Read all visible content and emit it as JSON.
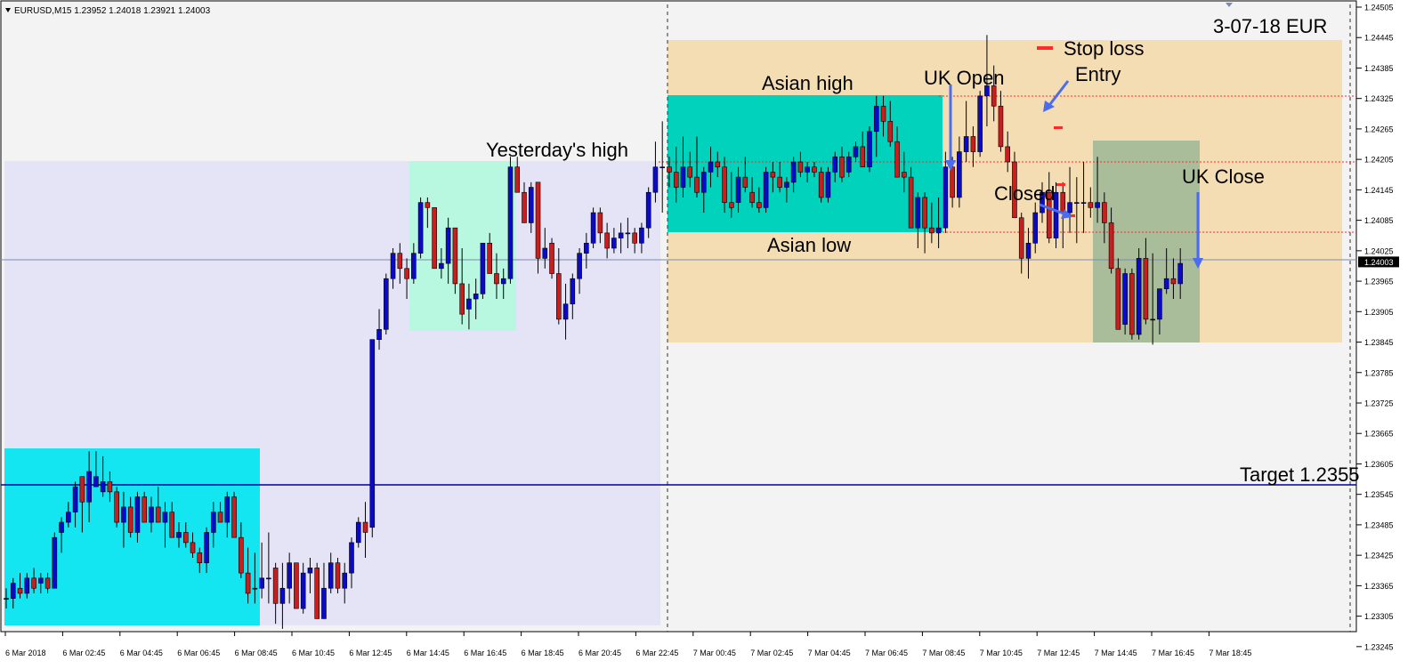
{
  "chart_header": "EURUSD,M15  1.23952 1.24018 1.23921 1.24003",
  "chart_menu_icon": "triangle-down-icon",
  "colors": {
    "background": "#f3f3f3",
    "bull_candle": "#0a0ac8",
    "bear_candle": "#c81e1e",
    "prev_day_zone": "#e4e4f6",
    "today_zone": "#f5ddb3",
    "asian_session_box": "#00d2bc",
    "prev_asian_box": "#13e6f0",
    "yesterday_high_box": "#b8f7e0",
    "uk_session_box": "#a9bd9a",
    "target_line": "#0000a0",
    "level_line": "#ff2a2a",
    "bid_line": "#7a8bb0",
    "annotation_arrow": "#4a6cf0"
  },
  "annotations": {
    "date_label": "3-07-18  EUR",
    "stop_loss": "Stop loss",
    "entry": "Entry",
    "uk_open": "UK Open",
    "asian_high": "Asian high",
    "asian_low": "Asian low",
    "yesterdays_high": "Yesterday's high",
    "closed": "Closed",
    "uk_close": "UK Close",
    "target": "Target  1.2355"
  },
  "price_axis": {
    "labels": [
      "1.24505",
      "1.24445",
      "1.24385",
      "1.24325",
      "1.24265",
      "1.24205",
      "1.24145",
      "1.24085",
      "1.24025",
      "1.23965",
      "1.23905",
      "1.23845",
      "1.23785",
      "1.23725",
      "1.23665",
      "1.23605",
      "1.23545",
      "1.23485",
      "1.23425",
      "1.23365",
      "1.23305",
      "1.23245"
    ],
    "current_price": "1.24003"
  },
  "time_axis": {
    "labels": [
      "6 Mar 2018",
      "6 Mar 02:45",
      "6 Mar 04:45",
      "6 Mar 06:45",
      "6 Mar 08:45",
      "6 Mar 10:45",
      "6 Mar 12:45",
      "6 Mar 14:45",
      "6 Mar 16:45",
      "6 Mar 18:45",
      "6 Mar 20:45",
      "6 Mar 22:45",
      "7 Mar 00:45",
      "7 Mar 02:45",
      "7 Mar 04:45",
      "7 Mar 06:45",
      "7 Mar 08:45",
      "7 Mar 10:45",
      "7 Mar 12:45",
      "7 Mar 14:45",
      "7 Mar 16:45",
      "7 Mar 18:45"
    ]
  },
  "chart_data": {
    "type": "candlestick",
    "symbol": "EURUSD",
    "timeframe": "M15",
    "last_bar": {
      "open": 1.23952,
      "high": 1.24018,
      "low": 1.23921,
      "close": 1.24003
    },
    "ylim": [
      1.2322,
      1.2451
    ],
    "levels": {
      "yesterdays_high": 1.2421,
      "asian_high": 1.2434,
      "asian_low": 1.2406,
      "target": 1.2355,
      "current": 1.24003,
      "stop_loss": 1.2445,
      "entry": 1.2431,
      "closed": 1.241
    },
    "candles": [
      [
        1.2334,
        1.2336,
        1.2332,
        1.2334
      ],
      [
        1.2334,
        1.2338,
        1.2332,
        1.2337
      ],
      [
        1.2336,
        1.2339,
        1.2334,
        1.2335
      ],
      [
        1.2335,
        1.2339,
        1.2334,
        1.2338
      ],
      [
        1.2338,
        1.234,
        1.2335,
        1.2336
      ],
      [
        1.2337,
        1.2339,
        1.2335,
        1.2338
      ],
      [
        1.2338,
        1.2339,
        1.2335,
        1.2336
      ],
      [
        1.2336,
        1.2347,
        1.2336,
        1.2346
      ],
      [
        1.2347,
        1.235,
        1.2343,
        1.2349
      ],
      [
        1.2349,
        1.2353,
        1.2348,
        1.2351
      ],
      [
        1.2351,
        1.2357,
        1.2348,
        1.2356
      ],
      [
        1.2358,
        1.2358,
        1.2347,
        1.2353
      ],
      [
        1.2353,
        1.2363,
        1.2349,
        1.2359
      ],
      [
        1.2356,
        1.2363,
        1.2356,
        1.2358
      ],
      [
        1.2355,
        1.2362,
        1.2354,
        1.2357
      ],
      [
        1.2357,
        1.2359,
        1.2353,
        1.2355
      ],
      [
        1.2355,
        1.2356,
        1.2348,
        1.2349
      ],
      [
        1.2349,
        1.2355,
        1.2344,
        1.2352
      ],
      [
        1.2352,
        1.2354,
        1.2346,
        1.2347
      ],
      [
        1.2347,
        1.2355,
        1.2345,
        1.2354
      ],
      [
        1.2354,
        1.2355,
        1.2349,
        1.2349
      ],
      [
        1.2349,
        1.2354,
        1.2347,
        1.2352
      ],
      [
        1.2352,
        1.2356,
        1.2349,
        1.2349
      ],
      [
        1.2349,
        1.2353,
        1.2344,
        1.2351
      ],
      [
        1.2351,
        1.2353,
        1.2346,
        1.2346
      ],
      [
        1.2346,
        1.2349,
        1.2344,
        1.2347
      ],
      [
        1.2347,
        1.2349,
        1.2344,
        1.2345
      ],
      [
        1.2345,
        1.2347,
        1.2342,
        1.2343
      ],
      [
        1.2343,
        1.2344,
        1.2339,
        1.2341
      ],
      [
        1.2341,
        1.2348,
        1.2339,
        1.2347
      ],
      [
        1.2347,
        1.2353,
        1.2344,
        1.2351
      ],
      [
        1.2351,
        1.2353,
        1.2349,
        1.2349
      ],
      [
        1.2349,
        1.2355,
        1.2346,
        1.2354
      ],
      [
        1.2354,
        1.2355,
        1.2347,
        1.2346
      ],
      [
        1.2346,
        1.2349,
        1.2338,
        1.2339
      ],
      [
        1.2339,
        1.2344,
        1.2333,
        1.2335
      ],
      [
        1.2336,
        1.2343,
        1.2333,
        1.2336
      ],
      [
        1.2336,
        1.2345,
        1.2334,
        1.2338
      ],
      [
        1.2338,
        1.2347,
        1.2333,
        1.2338
      ],
      [
        1.234,
        1.2341,
        1.2329,
        1.2333
      ],
      [
        1.2333,
        1.2341,
        1.2328,
        1.2336
      ],
      [
        1.2336,
        1.2343,
        1.2333,
        1.2341
      ],
      [
        1.2341,
        1.2341,
        1.2333,
        1.2332
      ],
      [
        1.2332,
        1.2341,
        1.2331,
        1.2339
      ],
      [
        1.2339,
        1.2342,
        1.2335,
        1.234
      ],
      [
        1.234,
        1.2341,
        1.233,
        1.233
      ],
      [
        1.233,
        1.2341,
        1.233,
        1.2336
      ],
      [
        1.2336,
        1.2343,
        1.2335,
        1.2341
      ],
      [
        1.2341,
        1.2342,
        1.2335,
        1.2336
      ],
      [
        1.2336,
        1.2341,
        1.2333,
        1.2339
      ],
      [
        1.2339,
        1.2346,
        1.2336,
        1.2345
      ],
      [
        1.2345,
        1.235,
        1.2344,
        1.2349
      ],
      [
        1.2349,
        1.2353,
        1.2342,
        1.2347
      ],
      [
        1.2348,
        1.2385,
        1.2346,
        1.2385
      ],
      [
        1.2385,
        1.2391,
        1.2383,
        1.2387
      ],
      [
        1.2387,
        1.2398,
        1.2386,
        1.2397
      ],
      [
        1.2397,
        1.2403,
        1.2395,
        1.2402
      ],
      [
        1.2402,
        1.2404,
        1.2396,
        1.2399
      ],
      [
        1.2399,
        1.2401,
        1.2393,
        1.2397
      ],
      [
        1.2397,
        1.2404,
        1.2396,
        1.2402
      ],
      [
        1.2402,
        1.2413,
        1.2401,
        1.2412
      ],
      [
        1.2412,
        1.2413,
        1.2407,
        1.2411
      ],
      [
        1.2411,
        1.2411,
        1.24,
        1.2399
      ],
      [
        1.2399,
        1.2403,
        1.2397,
        1.24
      ],
      [
        1.24,
        1.2409,
        1.2396,
        1.2407
      ],
      [
        1.2407,
        1.2407,
        1.2394,
        1.2396
      ],
      [
        1.2396,
        1.2403,
        1.2388,
        1.239
      ],
      [
        1.2391,
        1.2396,
        1.2387,
        1.2393
      ],
      [
        1.2393,
        1.2397,
        1.2389,
        1.2394
      ],
      [
        1.2394,
        1.2404,
        1.2393,
        1.2404
      ],
      [
        1.2404,
        1.2406,
        1.2398,
        1.2398
      ],
      [
        1.2398,
        1.2402,
        1.2393,
        1.2396
      ],
      [
        1.2396,
        1.2399,
        1.2393,
        1.2397
      ],
      [
        1.2397,
        1.2421,
        1.2396,
        1.2419
      ],
      [
        1.2419,
        1.2421,
        1.2415,
        1.2414
      ],
      [
        1.2414,
        1.2416,
        1.2411,
        1.2408
      ],
      [
        1.2408,
        1.2416,
        1.2406,
        1.2415
      ],
      [
        1.2416,
        1.2416,
        1.2398,
        1.2401
      ],
      [
        1.2401,
        1.2407,
        1.2399,
        1.2403
      ],
      [
        1.2404,
        1.2405,
        1.2397,
        1.2398
      ],
      [
        1.2398,
        1.2403,
        1.2388,
        1.2389
      ],
      [
        1.2389,
        1.2396,
        1.2385,
        1.2392
      ],
      [
        1.2392,
        1.2398,
        1.2389,
        1.2397
      ],
      [
        1.2397,
        1.2403,
        1.2394,
        1.2402
      ],
      [
        1.2402,
        1.2406,
        1.2399,
        1.2404
      ],
      [
        1.2404,
        1.2411,
        1.2403,
        1.241
      ],
      [
        1.241,
        1.2411,
        1.2404,
        1.2406
      ],
      [
        1.2406,
        1.2408,
        1.2401,
        1.2403
      ],
      [
        1.2403,
        1.2407,
        1.2402,
        1.2405
      ],
      [
        1.2405,
        1.2408,
        1.2402,
        1.2406
      ],
      [
        1.2406,
        1.2409,
        1.2403,
        1.2406
      ],
      [
        1.2406,
        1.2407,
        1.2402,
        1.2404
      ],
      [
        1.2404,
        1.2408,
        1.2402,
        1.2407
      ],
      [
        1.2407,
        1.2415,
        1.2405,
        1.2414
      ],
      [
        1.2414,
        1.2424,
        1.2412,
        1.2419
      ],
      [
        1.2419,
        1.2428,
        1.241,
        1.2419
      ],
      [
        1.2419,
        1.2421,
        1.2415,
        1.2418
      ],
      [
        1.2418,
        1.2423,
        1.2412,
        1.2415
      ],
      [
        1.2415,
        1.2425,
        1.2413,
        1.2419
      ],
      [
        1.2419,
        1.2422,
        1.2415,
        1.2417
      ],
      [
        1.2417,
        1.2425,
        1.2413,
        1.2414
      ],
      [
        1.2414,
        1.2419,
        1.241,
        1.2418
      ],
      [
        1.2418,
        1.2423,
        1.2415,
        1.242
      ],
      [
        1.242,
        1.2422,
        1.2417,
        1.2419
      ],
      [
        1.2419,
        1.2421,
        1.241,
        1.2412
      ],
      [
        1.2412,
        1.2418,
        1.2409,
        1.2411
      ],
      [
        1.2412,
        1.2419,
        1.241,
        1.2417
      ],
      [
        1.2417,
        1.2421,
        1.2414,
        1.2415
      ],
      [
        1.2414,
        1.2417,
        1.2411,
        1.2412
      ],
      [
        1.2412,
        1.2415,
        1.241,
        1.2411
      ],
      [
        1.2411,
        1.2419,
        1.241,
        1.2418
      ],
      [
        1.2418,
        1.242,
        1.2414,
        1.2417
      ],
      [
        1.2417,
        1.242,
        1.2414,
        1.2415
      ],
      [
        1.2415,
        1.2417,
        1.2412,
        1.2416
      ],
      [
        1.2416,
        1.2421,
        1.2414,
        1.242
      ],
      [
        1.242,
        1.2422,
        1.2417,
        1.2418
      ],
      [
        1.2418,
        1.242,
        1.2416,
        1.2419
      ],
      [
        1.2419,
        1.242,
        1.2417,
        1.2418
      ],
      [
        1.2418,
        1.2419,
        1.2412,
        1.2413
      ],
      [
        1.2413,
        1.2419,
        1.2412,
        1.2418
      ],
      [
        1.2418,
        1.2422,
        1.2416,
        1.2421
      ],
      [
        1.2421,
        1.2423,
        1.2416,
        1.2417
      ],
      [
        1.2418,
        1.2422,
        1.2417,
        1.2421
      ],
      [
        1.2421,
        1.2424,
        1.242,
        1.2423
      ],
      [
        1.2423,
        1.2426,
        1.2419,
        1.2419
      ],
      [
        1.2419,
        1.2427,
        1.2418,
        1.2426
      ],
      [
        1.2426,
        1.2433,
        1.2421,
        1.2431
      ],
      [
        1.2431,
        1.2433,
        1.2425,
        1.2428
      ],
      [
        1.2428,
        1.2432,
        1.2423,
        1.2424
      ],
      [
        1.2424,
        1.2427,
        1.2417,
        1.2417
      ],
      [
        1.2418,
        1.2422,
        1.2414,
        1.2417
      ],
      [
        1.2417,
        1.2419,
        1.2407,
        1.2407
      ],
      [
        1.2407,
        1.2414,
        1.2403,
        1.2413
      ],
      [
        1.2413,
        1.2414,
        1.2402,
        1.2407
      ],
      [
        1.2407,
        1.2412,
        1.2404,
        1.2406
      ],
      [
        1.2406,
        1.2413,
        1.2403,
        1.2407
      ],
      [
        1.2407,
        1.2422,
        1.2406,
        1.2419
      ],
      [
        1.2419,
        1.2421,
        1.2411,
        1.2413
      ],
      [
        1.2413,
        1.2425,
        1.2411,
        1.2422
      ],
      [
        1.2422,
        1.2432,
        1.242,
        1.2425
      ],
      [
        1.2425,
        1.2427,
        1.2419,
        1.2422
      ],
      [
        1.2422,
        1.2434,
        1.2421,
        1.2433
      ],
      [
        1.2433,
        1.2445,
        1.2427,
        1.2435
      ],
      [
        1.2435,
        1.2439,
        1.2428,
        1.2431
      ],
      [
        1.2431,
        1.2434,
        1.2422,
        1.2423
      ],
      [
        1.2423,
        1.2426,
        1.2418,
        1.242
      ],
      [
        1.242,
        1.2422,
        1.2412,
        1.2409
      ],
      [
        1.2409,
        1.241,
        1.2398,
        1.2401
      ],
      [
        1.2401,
        1.2407,
        1.2397,
        1.2404
      ],
      [
        1.2404,
        1.2412,
        1.2402,
        1.241
      ],
      [
        1.241,
        1.2416,
        1.2408,
        1.2414
      ],
      [
        1.2414,
        1.2418,
        1.2404,
        1.2405
      ],
      [
        1.2405,
        1.2416,
        1.2403,
        1.2414
      ],
      [
        1.2414,
        1.2416,
        1.2403,
        1.241
      ],
      [
        1.241,
        1.2419,
        1.2406,
        1.2412
      ],
      [
        1.2412,
        1.2417,
        1.2404,
        1.2412
      ],
      [
        1.2412,
        1.242,
        1.2406,
        1.2412
      ],
      [
        1.2412,
        1.2415,
        1.2409,
        1.2411
      ],
      [
        1.2411,
        1.2421,
        1.2408,
        1.2412
      ],
      [
        1.2412,
        1.2414,
        1.2404,
        1.2408
      ],
      [
        1.2408,
        1.2411,
        1.2398,
        1.2399
      ],
      [
        1.2399,
        1.2401,
        1.2387,
        1.2387
      ],
      [
        1.2388,
        1.2399,
        1.2386,
        1.2398
      ],
      [
        1.2398,
        1.2399,
        1.2385,
        1.2386
      ],
      [
        1.2386,
        1.2403,
        1.2385,
        1.2401
      ],
      [
        1.2401,
        1.2405,
        1.2388,
        1.2389
      ],
      [
        1.2389,
        1.2402,
        1.2384,
        1.2389
      ],
      [
        1.2389,
        1.2395,
        1.2386,
        1.2395
      ],
      [
        1.2395,
        1.2403,
        1.2394,
        1.2397
      ],
      [
        1.2397,
        1.2401,
        1.2393,
        1.2396
      ],
      [
        1.2396,
        1.2403,
        1.2393,
        1.24
      ]
    ]
  }
}
